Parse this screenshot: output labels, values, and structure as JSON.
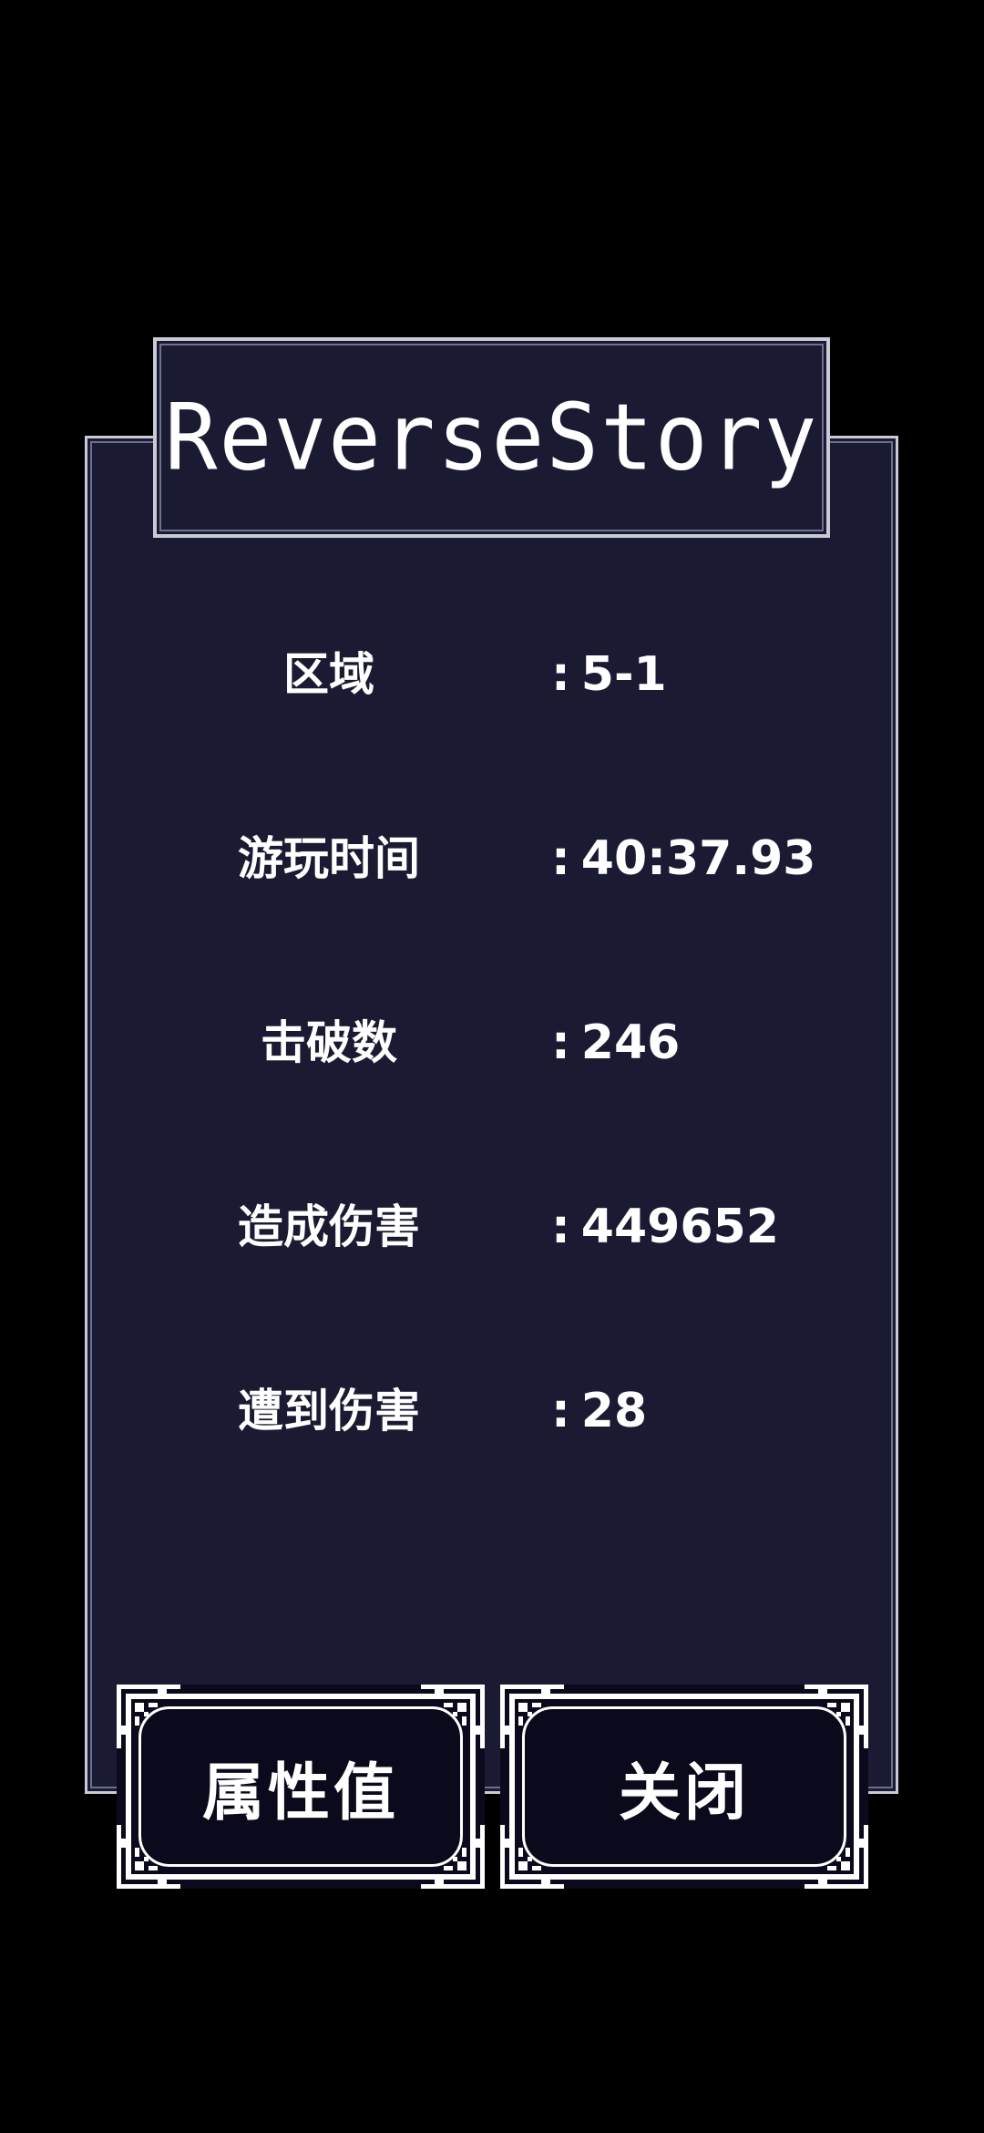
{
  "title": "ReverseStory",
  "stats": [
    {
      "label": "区域",
      "value": "5-1"
    },
    {
      "label": "游玩时间",
      "value": "40:37.93"
    },
    {
      "label": "击破数",
      "value": "246"
    },
    {
      "label": "造成伤害",
      "value": "449652"
    },
    {
      "label": "遭到伤害",
      "value": "28"
    }
  ],
  "colon": ":",
  "buttons": {
    "attributes": "属性值",
    "close": "关闭"
  },
  "colors": {
    "background": "#000000",
    "panel": "#1a1b33",
    "border": "#c9cad6",
    "button_bg": "#0a0a1c",
    "text": "#ffffff"
  }
}
